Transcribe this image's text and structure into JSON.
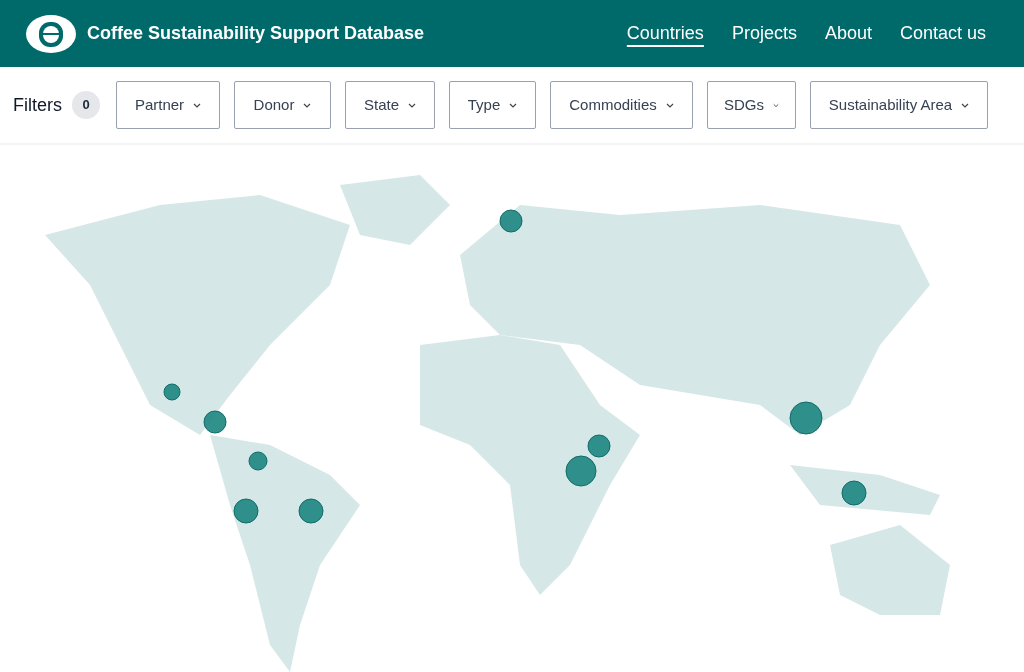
{
  "header": {
    "title": "Coffee Sustainability Support Database"
  },
  "nav": [
    {
      "label": "Countries",
      "selected": true
    },
    {
      "label": "Projects",
      "selected": false
    },
    {
      "label": "About",
      "selected": false
    },
    {
      "label": "Contact us",
      "selected": false
    }
  ],
  "filters": {
    "label": "Filters",
    "count": "0",
    "dropdowns": [
      "Partner",
      "Donor",
      "State",
      "Type",
      "Commodities",
      "SDGs",
      "Sustainability Area"
    ]
  }
}
